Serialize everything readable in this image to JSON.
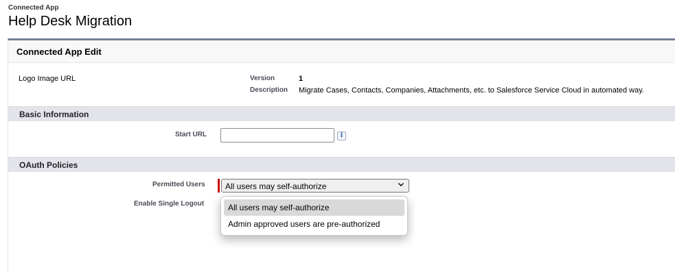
{
  "header": {
    "type": "Connected App",
    "title": "Help Desk Migration"
  },
  "panel": {
    "title": "Connected App Edit"
  },
  "details": {
    "logo_label": "Logo Image URL",
    "version_label": "Version",
    "version_value": "1",
    "description_label": "Description",
    "description_value": "Migrate Cases, Contacts, Companies, Attachments, etc. to Salesforce Service Cloud in automated way."
  },
  "basic_info": {
    "section_title": "Basic Information",
    "start_url_label": "Start URL",
    "start_url_value": "",
    "info_icon_glyph": "i"
  },
  "oauth": {
    "section_title": "OAuth Policies",
    "permitted_users_label": "Permitted Users",
    "permitted_users_value": "All users may self-authorize",
    "single_logout_label": "Enable Single Logout",
    "options": [
      "All users may self-authorize",
      "Admin approved users are pre-authorized"
    ]
  },
  "colors": {
    "panel_border": "#737e96",
    "section_bg": "#e3e3ec",
    "required": "#cc0000"
  },
  "icons": {
    "info": "info-icon",
    "dropdown": "chevron-down-icon"
  }
}
